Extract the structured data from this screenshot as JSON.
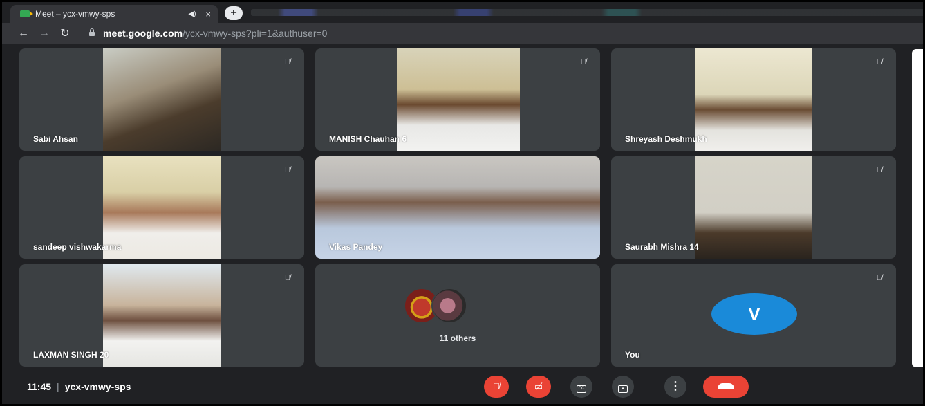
{
  "browser": {
    "tab_title": "Meet – ycx-vmwy-sps",
    "tab_audio_icon": "speaker-icon",
    "tab_close": "×",
    "new_tab": "+",
    "url_host": "meet.google.com",
    "url_path": "/ycx-vmwy-sps?pli=1&authuser=0"
  },
  "participants": [
    {
      "name": "Sabi Ahsan",
      "muted": true
    },
    {
      "name": "MANISH Chauhan 6",
      "muted": true
    },
    {
      "name": "Shreyash Deshmukh",
      "muted": true
    },
    {
      "name": "sandeep vishwakarma",
      "muted": true
    },
    {
      "name": "Vikas Pandey",
      "muted": false
    },
    {
      "name": "Saurabh Mishra 14",
      "muted": true
    },
    {
      "name": "LAXMAN SINGH 20",
      "muted": true
    },
    {
      "name": "11 others",
      "muted": false
    },
    {
      "name": "You",
      "muted": true
    }
  ],
  "self": {
    "initial": "V",
    "avatar_color": "#1a8ad9"
  },
  "meeting": {
    "time": "11:45",
    "separator": "|",
    "code": "ycx-vmwy-sps"
  },
  "controls": {
    "mic": "mic-off-icon",
    "camera": "camera-off-icon",
    "captions": "CC",
    "present": "present-icon",
    "more": "⋮",
    "leave": "phone-hangup-icon"
  },
  "colors": {
    "danger": "#ea4335",
    "tile": "#3c4043",
    "background": "#202124"
  }
}
